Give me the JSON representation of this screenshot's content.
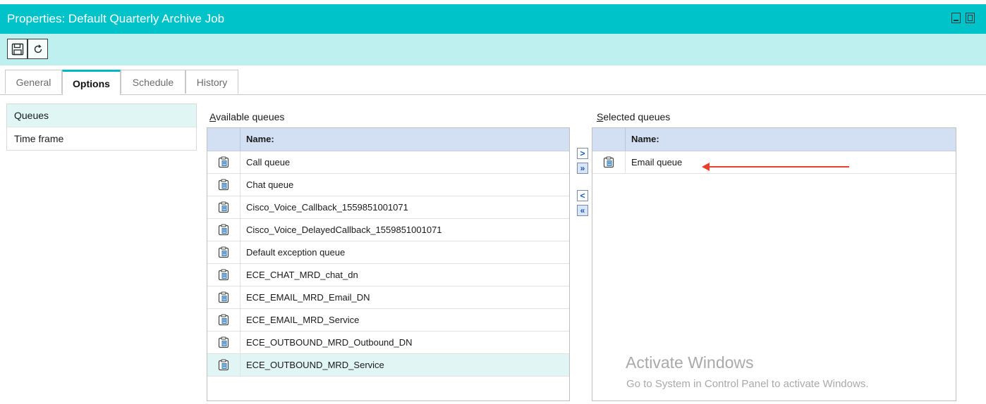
{
  "window": {
    "title": "Properties: Default Quarterly Archive Job",
    "minimize_icon": "minimize-icon",
    "maximize_icon": "maximize-icon"
  },
  "toolbar": {
    "save_icon": "floppy-disk-icon",
    "refresh_icon": "refresh-icon"
  },
  "tabs": [
    {
      "label": "General",
      "active": false
    },
    {
      "label": "Options",
      "active": true
    },
    {
      "label": "Schedule",
      "active": false
    },
    {
      "label": "History",
      "active": false
    }
  ],
  "left_nav": {
    "items": [
      {
        "label": "Queues",
        "selected": true
      },
      {
        "label": "Time frame",
        "selected": false
      }
    ]
  },
  "available": {
    "label_accesskey": "A",
    "label_rest": "vailable queues",
    "header": "Name:",
    "rows": [
      "Call queue",
      "Chat queue",
      "Cisco_Voice_Callback_1559851001071",
      "Cisco_Voice_DelayedCallback_1559851001071",
      "Default exception queue",
      "ECE_CHAT_MRD_chat_dn",
      "ECE_EMAIL_MRD_Email_DN",
      "ECE_EMAIL_MRD_Service",
      "ECE_OUTBOUND_MRD_Outbound_DN",
      "ECE_OUTBOUND_MRD_Service"
    ],
    "highlighted_row": 9,
    "row_icon": "queue-clipboard-icon"
  },
  "transfer_buttons": {
    "add": ">",
    "add_all": "»",
    "remove": "<",
    "remove_all": "«"
  },
  "selected": {
    "label_accesskey": "S",
    "label_rest": "elected queues",
    "header": "Name:",
    "rows": [
      "Email queue"
    ],
    "annotation": "red-arrow-pointing-left"
  },
  "watermark": {
    "line1": "Activate Windows",
    "line2": "Go to System in Control Panel to activate Windows."
  },
  "colors": {
    "titlebar": "#00c3c9",
    "toolbar": "#bdf0ef",
    "grid_header": "#d3e0f4",
    "selection": "#e1f5f4",
    "annotation_arrow": "#e8412b"
  }
}
